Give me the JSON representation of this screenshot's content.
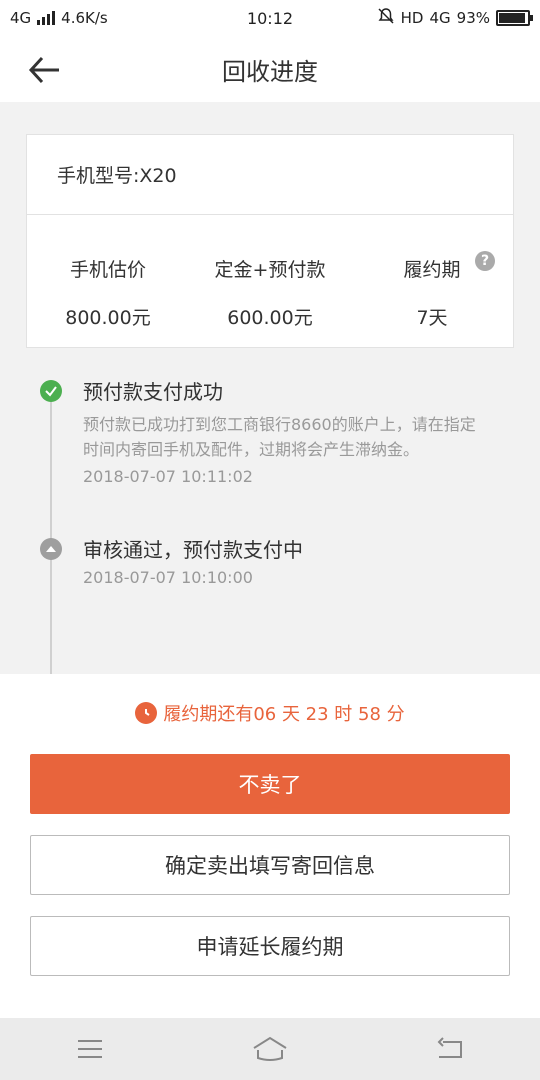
{
  "status_bar": {
    "network": "4G",
    "speed": "4.6K/s",
    "time": "10:12",
    "hd": "HD",
    "network_right": "4G",
    "battery": "93%",
    "battery_level": 0.93
  },
  "header": {
    "title": "回收进度"
  },
  "card": {
    "model_label": "手机型号:X20",
    "columns": [
      {
        "label": "手机估价",
        "value": "800.00元"
      },
      {
        "label": "定金+预付款",
        "value": "600.00元"
      },
      {
        "label": "履约期",
        "value": "7天"
      }
    ],
    "help_glyph": "?"
  },
  "timeline": [
    {
      "title": "预付款支付成功",
      "desc": "预付款已成功打到您工商银行8660的账户上，请在指定时间内寄回手机及配件，过期将会产生滞纳金。",
      "time": "2018-07-07 10:11:02",
      "status": "done"
    },
    {
      "title": "审核通过，预付款支付中",
      "time": "2018-07-07 10:10:00",
      "status": "pending"
    }
  ],
  "countdown": {
    "text": "履约期还有06 天 23 时 58 分"
  },
  "buttons": {
    "cancel_sale": "不卖了",
    "confirm_sale": "确定卖出填写寄回信息",
    "extend": "申请延长履约期"
  },
  "colors": {
    "accent": "#e8643c",
    "success": "#4caf50",
    "pending": "#9e9e9e"
  }
}
